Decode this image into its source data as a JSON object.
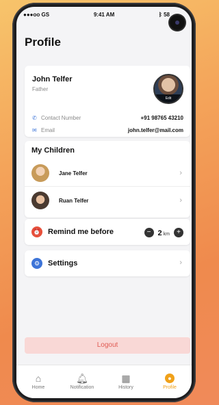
{
  "status": {
    "carrier": "●●●oo GS",
    "time": "9:41 AM",
    "battery": "58"
  },
  "page": {
    "title": "Profile"
  },
  "profile": {
    "name": "John Telfer",
    "role": "Father",
    "avatar_edit": "Edit",
    "contact_label": "Contact Number",
    "contact_value": "+91 98765 43210",
    "email_label": "Email",
    "email_value": "john.telfer@mail.com"
  },
  "children": {
    "title": "My Children",
    "items": [
      {
        "name": "Jane Telfer"
      },
      {
        "name": "Ruan Telfer"
      }
    ]
  },
  "remind": {
    "label": "Remind me before",
    "value": "2",
    "unit": "km",
    "minus": "−",
    "plus": "+"
  },
  "settings": {
    "label": "Settings"
  },
  "logout": {
    "label": "Logout"
  },
  "tabs": [
    {
      "label": "Home",
      "icon": "home-icon"
    },
    {
      "label": "Notification",
      "icon": "bell-icon"
    },
    {
      "label": "History",
      "icon": "calendar-icon"
    },
    {
      "label": "Profile",
      "icon": "profile-icon"
    }
  ],
  "colors": {
    "accent": "#f0a11a",
    "logout_text": "#e05a52",
    "logout_bg": "#f9d8d6",
    "email_icon": "#3d74d8",
    "remind_icon": "#e8503a",
    "settings_icon": "#3d74d8"
  }
}
